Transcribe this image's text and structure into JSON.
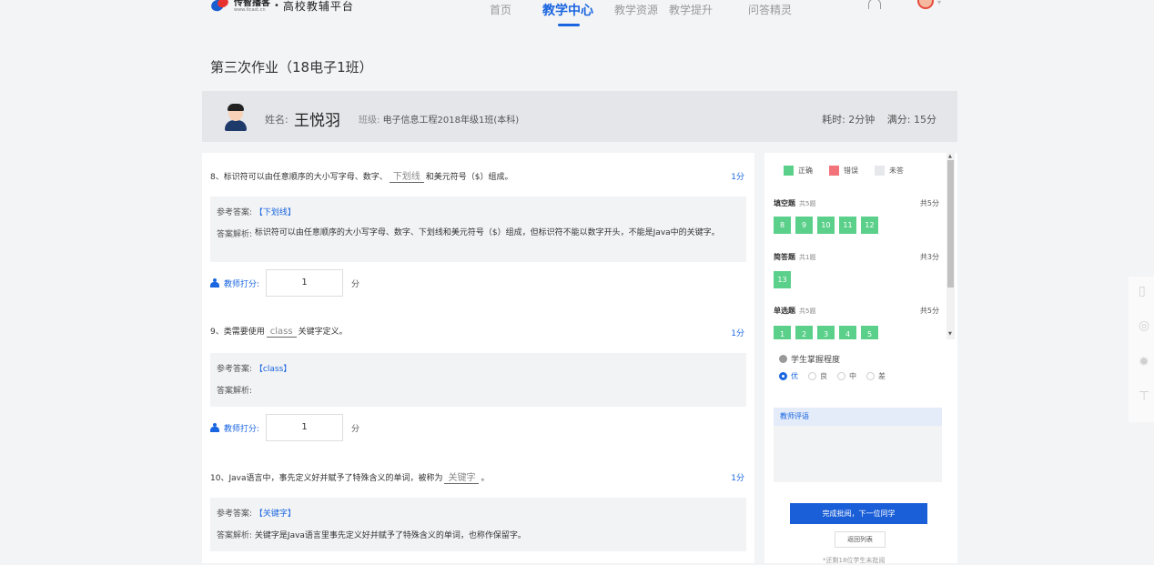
{
  "header": {
    "logo_name": "传智播客",
    "logo_url": "www.itcast.cn",
    "logo_dot": "•",
    "platform": "高校教辅平台",
    "nav": [
      "首页",
      "教学中心",
      "教学资源",
      "教学提升",
      "问答精灵"
    ],
    "active_nav": "教学中心"
  },
  "page_title": "第三次作业（18电子1班）",
  "student": {
    "name_label": "姓名:",
    "name": "王悦羽",
    "class_label": "班级:",
    "class_value": "电子信息工程2018年级1班(本科)",
    "time": "耗时: 2分钟",
    "full_score": "满分: 15分"
  },
  "questions": [
    {
      "text_pre": "8、标识符可以由任意顺序的大小写字母、数字、",
      "blank": "下划线",
      "text_post": "和美元符号（$）组成。",
      "score": "1分",
      "ref_label": "参考答案:",
      "ref_answer": "【下划线】",
      "analysis_label": "答案解析:",
      "analysis": "标识符可以由任意顺序的大小写字母、数字、下划线和美元符号（$）组成，但标识符不能以数字开头，不能是Java中的关键字。",
      "teacher_label": "教师打分:",
      "teacher_score": "1",
      "unit": "分"
    },
    {
      "text_pre": "9、类需要使用",
      "blank": "class",
      "text_post": "关键字定义。",
      "score": "1分",
      "ref_label": "参考答案:",
      "ref_answer": "【class】",
      "analysis_label": "答案解析:",
      "analysis": "",
      "teacher_label": "教师打分:",
      "teacher_score": "1",
      "unit": "分"
    },
    {
      "text_pre": "10、Java语言中，事先定义好并赋予了特殊含义的单词，被称为",
      "blank": "关键字",
      "text_post": "。",
      "score": "1分",
      "ref_label": "参考答案:",
      "ref_answer": "【关键字】",
      "analysis_label": "答案解析:",
      "analysis": "关键字是Java语言里事先定义好并赋予了特殊含义的单词，也称作保留字。"
    }
  ],
  "legend": {
    "correct": "正确",
    "wrong": "错误",
    "unanswered": "未答"
  },
  "colors": {
    "correct": "#5bd08a",
    "wrong": "#f2737a",
    "unanswered": "#e6e8ec",
    "accent": "#1a66e0"
  },
  "sections": [
    {
      "name": "填空题",
      "count": "共5题",
      "total": "共5分",
      "items": [
        "8",
        "9",
        "10",
        "11",
        "12"
      ]
    },
    {
      "name": "简答题",
      "count": "共1题",
      "total": "共3分",
      "items": [
        "13"
      ]
    },
    {
      "name": "单选题",
      "count": "共5题",
      "total": "共5分",
      "items": [
        "1",
        "2",
        "3",
        "4",
        "5"
      ]
    }
  ],
  "mastery": {
    "title": "学生掌握程度",
    "options": [
      "优",
      "良",
      "中",
      "差"
    ],
    "selected": "优"
  },
  "comment_label": "教师评语",
  "finish_button": "完成批阅，下一位同学",
  "back_button": "返回列表",
  "remaining": "*还剩18位学生未批阅"
}
